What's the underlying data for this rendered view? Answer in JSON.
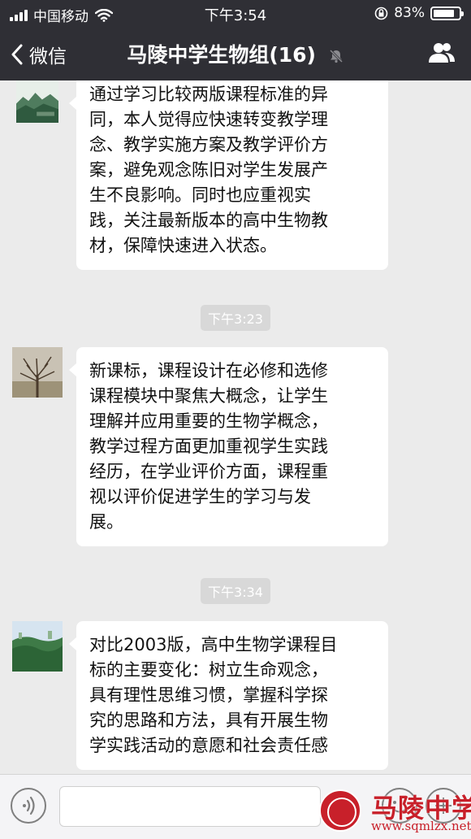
{
  "status_bar": {
    "carrier": "中国移动",
    "time": "下午3:54",
    "battery": "83%",
    "battery_level": 0.83
  },
  "nav": {
    "back_label": "微信",
    "title": "马陵中学生物组(16)"
  },
  "messages": [
    {
      "lines": [
        "通过学习比较两版课程标准的异",
        "同，本人觉得应快速转变教学理",
        "念、教学实施方案及教学评价方",
        "案，避免观念陈旧对学生发展产",
        "生不良影响。同时也应重视实",
        "践，关注最新版本的高中生物教",
        "材，保障快速进入状态。"
      ]
    },
    {
      "lines": [
        "新课标，课程设计在必修和选修",
        "课程模块中聚焦大概念，让学生",
        "理解并应用重要的生物学概念，",
        "教学过程方面更加重视学生实践",
        "经历，在学业评价方面，课程重",
        "视以评价促进学生的学习与发",
        "展。"
      ]
    },
    {
      "lines": [
        "对比2003版，高中生物学课程目",
        "标的主要变化：树立生命观念，",
        "具有理性思维习惯，掌握科学探",
        "究的思路和方法，具有开展生物",
        "学实践活动的意愿和社会责任感"
      ]
    }
  ],
  "timestamps": [
    "下午3:23",
    "下午3:34"
  ],
  "watermark": {
    "name": "马陵中学",
    "url": "www.sqmlzx.net"
  }
}
